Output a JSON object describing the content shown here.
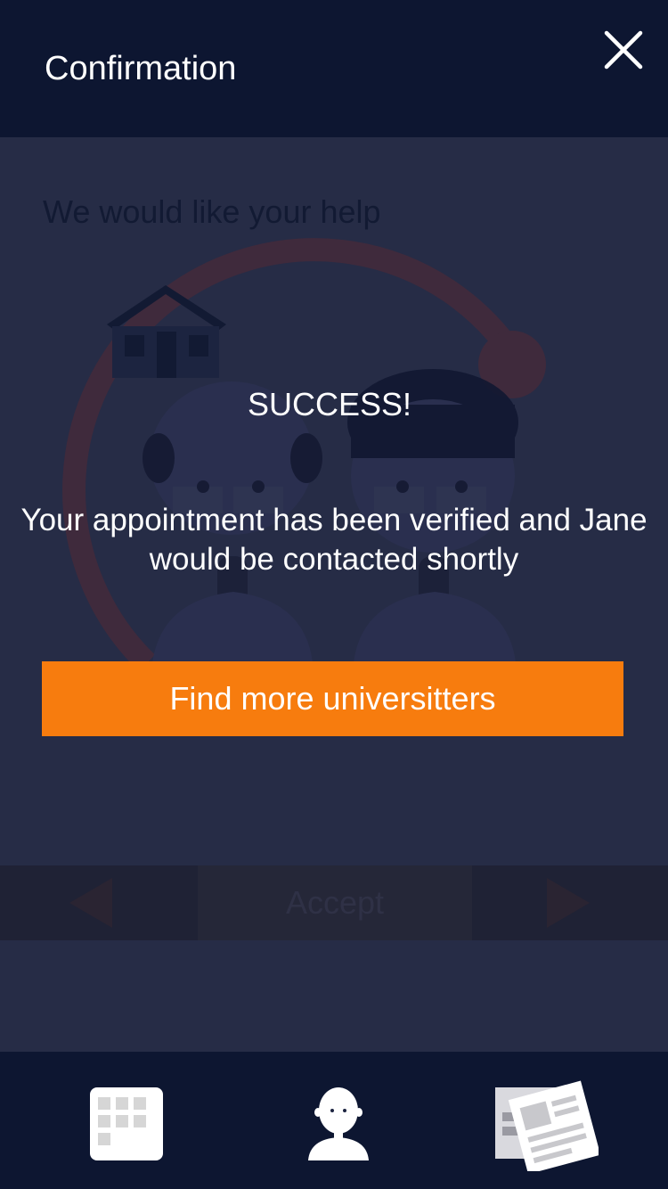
{
  "header": {
    "title": "Confirmation",
    "close_icon": "close-icon"
  },
  "background_screen": {
    "heading": "We would like your help",
    "accept_label": "Accept",
    "prev_icon": "triangle-left-icon",
    "next_icon": "triangle-right-icon"
  },
  "overlay": {
    "title": "SUCCESS!",
    "message": "Your appointment has been verified and Jane would be contacted shortly",
    "cta_label": "Find more universitters"
  },
  "tabbar": {
    "items": [
      {
        "name": "calendar",
        "icon": "calendar-grid-icon"
      },
      {
        "name": "profile",
        "icon": "person-icon"
      },
      {
        "name": "news",
        "icon": "newspaper-icon"
      }
    ]
  },
  "colors": {
    "header_bg": "#0d1631",
    "content_bg": "#262c46",
    "accent": "#f77c0e",
    "text": "#ffffff"
  }
}
